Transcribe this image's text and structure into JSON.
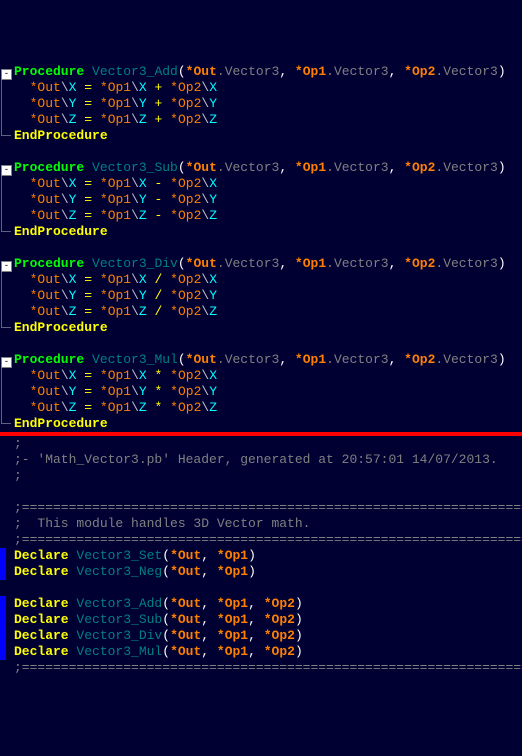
{
  "upper": {
    "procedures": [
      {
        "name": "Vector3_Add",
        "params": [
          {
            "ptr": "*Out",
            "type": "Vector3"
          },
          {
            "ptr": "*Op1",
            "type": "Vector3"
          },
          {
            "ptr": "*Op2",
            "type": "Vector3"
          }
        ],
        "body": [
          {
            "dst": "*Out",
            "dstf": "X",
            "a": "*Op1",
            "af": "X",
            "op": "+",
            "b": "*Op2",
            "bf": "X"
          },
          {
            "dst": "*Out",
            "dstf": "Y",
            "a": "*Op1",
            "af": "Y",
            "op": "+",
            "b": "*Op2",
            "bf": "Y"
          },
          {
            "dst": "*Out",
            "dstf": "Z",
            "a": "*Op1",
            "af": "Z",
            "op": "+",
            "b": "*Op2",
            "bf": "Z"
          }
        ],
        "end": "EndProcedure"
      },
      {
        "name": "Vector3_Sub",
        "params": [
          {
            "ptr": "*Out",
            "type": "Vector3"
          },
          {
            "ptr": "*Op1",
            "type": "Vector3"
          },
          {
            "ptr": "*Op2",
            "type": "Vector3"
          }
        ],
        "body": [
          {
            "dst": "*Out",
            "dstf": "X",
            "a": "*Op1",
            "af": "X",
            "op": "-",
            "b": "*Op2",
            "bf": "X"
          },
          {
            "dst": "*Out",
            "dstf": "Y",
            "a": "*Op1",
            "af": "Y",
            "op": "-",
            "b": "*Op2",
            "bf": "Y"
          },
          {
            "dst": "*Out",
            "dstf": "Z",
            "a": "*Op1",
            "af": "Z",
            "op": "-",
            "b": "*Op2",
            "bf": "Z"
          }
        ],
        "end": "EndProcedure"
      },
      {
        "name": "Vector3_Div",
        "params": [
          {
            "ptr": "*Out",
            "type": "Vector3"
          },
          {
            "ptr": "*Op1",
            "type": "Vector3"
          },
          {
            "ptr": "*Op2",
            "type": "Vector3"
          }
        ],
        "body": [
          {
            "dst": "*Out",
            "dstf": "X",
            "a": "*Op1",
            "af": "X",
            "op": "/",
            "b": "*Op2",
            "bf": "X"
          },
          {
            "dst": "*Out",
            "dstf": "Y",
            "a": "*Op1",
            "af": "Y",
            "op": "/",
            "b": "*Op2",
            "bf": "Y"
          },
          {
            "dst": "*Out",
            "dstf": "Z",
            "a": "*Op1",
            "af": "Z",
            "op": "/",
            "b": "*Op2",
            "bf": "Z"
          }
        ],
        "end": "EndProcedure"
      },
      {
        "name": "Vector3_Mul",
        "params": [
          {
            "ptr": "*Out",
            "type": "Vector3"
          },
          {
            "ptr": "*Op1",
            "type": "Vector3"
          },
          {
            "ptr": "*Op2",
            "type": "Vector3"
          }
        ],
        "body": [
          {
            "dst": "*Out",
            "dstf": "X",
            "a": "*Op1",
            "af": "X",
            "op": "*",
            "b": "*Op2",
            "bf": "X"
          },
          {
            "dst": "*Out",
            "dstf": "Y",
            "a": "*Op1",
            "af": "Y",
            "op": "*",
            "b": "*Op2",
            "bf": "Y"
          },
          {
            "dst": "*Out",
            "dstf": "Z",
            "a": "*Op1",
            "af": "Z",
            "op": "*",
            "b": "*Op2",
            "bf": "Z"
          }
        ],
        "end": "EndProcedure"
      }
    ],
    "kw_proc": "Procedure"
  },
  "lower": {
    "header_line": ";- 'Math_Vector3.pb' Header, generated at 20:57:01 14/07/2013.",
    "sep": ";==================================================================",
    "module_line": ";  This module handles 3D Vector math.",
    "kw_decl": "Declare",
    "declares1": [
      {
        "name": "Vector3_Set",
        "params": [
          "*Out",
          "*Op1"
        ]
      },
      {
        "name": "Vector3_Neg",
        "params": [
          "*Out",
          "*Op1"
        ]
      }
    ],
    "declares2": [
      {
        "name": "Vector3_Add",
        "params": [
          "*Out",
          "*Op1",
          "*Op2"
        ]
      },
      {
        "name": "Vector3_Sub",
        "params": [
          "*Out",
          "*Op1",
          "*Op2"
        ]
      },
      {
        "name": "Vector3_Div",
        "params": [
          "*Out",
          "*Op1",
          "*Op2"
        ]
      },
      {
        "name": "Vector3_Mul",
        "params": [
          "*Out",
          "*Op1",
          "*Op2"
        ]
      }
    ],
    "semi": ";"
  }
}
